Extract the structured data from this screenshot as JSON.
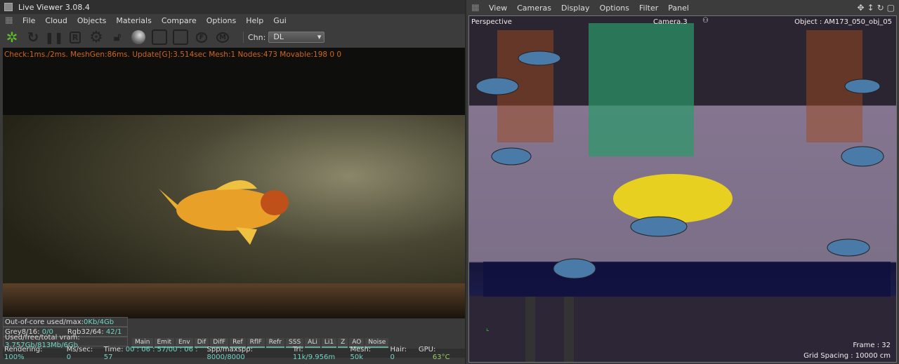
{
  "left": {
    "title": "Live Viewer 3.08.4",
    "menu": [
      "File",
      "Cloud",
      "Objects",
      "Materials",
      "Compare",
      "Options",
      "Help",
      "Gui"
    ],
    "toolbar": {
      "channel_label": "Chn:",
      "channel_value": "DL",
      "reset": "R",
      "fly_f": "F",
      "marker_m": "M"
    },
    "info_line": "Check:1ms./2ms. MeshGen:86ms. Update[G]:3.514sec Mesh:1 Nodes:473 Movable:198  0 0",
    "stats": {
      "ooc_label": "Out-of-core used/max:",
      "ooc_value": "0Kb/4Gb",
      "grey_label": "Grey8/16:",
      "grey_value": "0/0",
      "rgb_label": "Rgb32/64:",
      "rgb_value": "42/1",
      "vram_label": "Used/free/total vram:",
      "vram_value": "3.757Gb/813Mb/6Gb"
    },
    "channels": [
      "Main",
      "Emit",
      "Env",
      "Dif",
      "DifF",
      "Ref",
      "RflF",
      "Refr",
      "SSS",
      "ALi",
      "Li1",
      "Z",
      "AO",
      "Noise"
    ],
    "status": {
      "rendering_label": "Rendering:",
      "rendering_value": "100%",
      "ms_label": "Ms/sec:",
      "ms_value": "0",
      "time_label": "Time:",
      "time_value": "00 : 06 : 57/00 : 06 : 57",
      "spp_label": "Spp/maxspp:",
      "spp_value": "8000/8000",
      "tri_label": "Tri:",
      "tri_value": "11k/9.956m",
      "mesh_label": "Mesh:",
      "mesh_value": "50k",
      "hair_label": "Hair:",
      "hair_value": "0",
      "gpu_label": "GPU:",
      "gpu_temp": "63°C"
    }
  },
  "right": {
    "menu": [
      "View",
      "Cameras",
      "Display",
      "Options",
      "Filter",
      "Panel"
    ],
    "viewport": {
      "mode": "Perspective",
      "camera": "Camera.3",
      "object": "Object : AM173_050_obj_05",
      "frame": "Frame : 32",
      "grid": "Grid Spacing : 10000 cm"
    }
  },
  "colors": {
    "info": "#d0661a",
    "value": "#6fd4c4",
    "green_logo": "#5cc02a"
  }
}
